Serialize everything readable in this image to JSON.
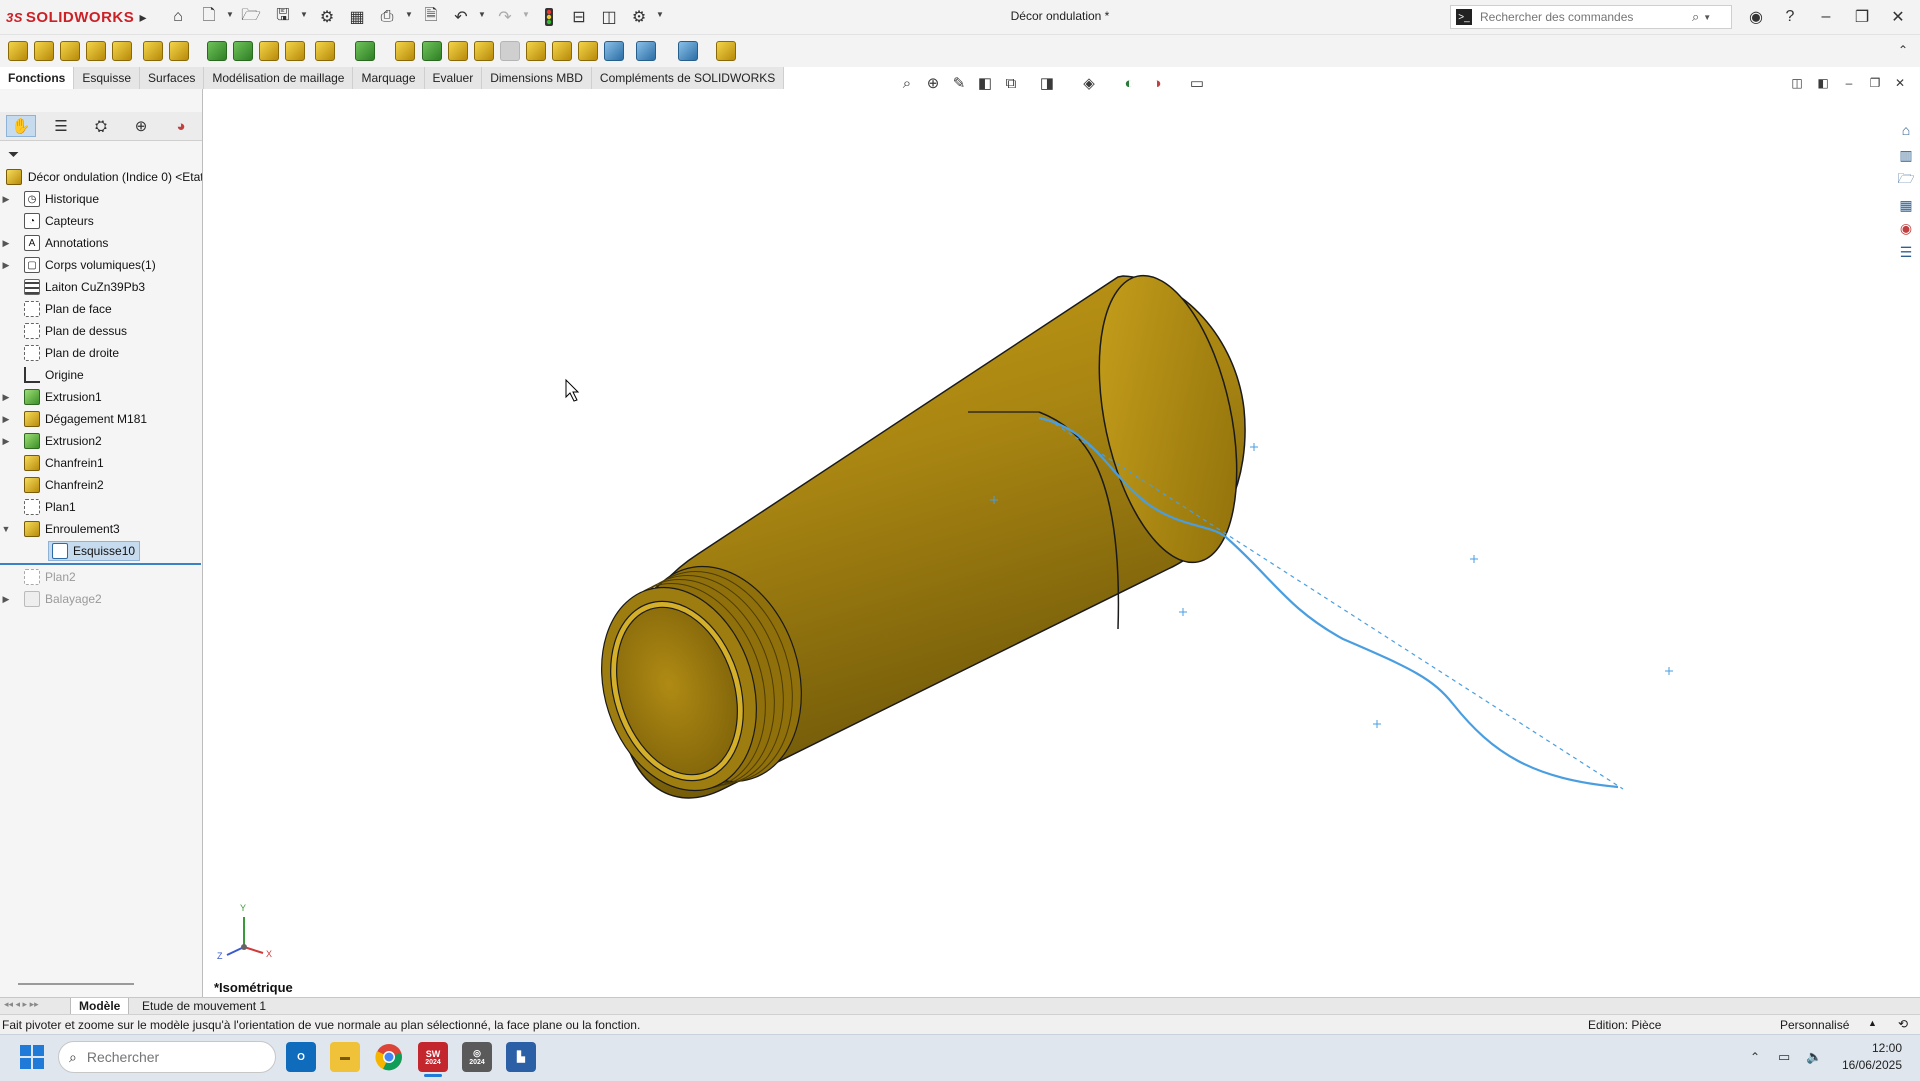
{
  "app": {
    "logo_brand": "SOLIDWORKS",
    "document_title": "Décor ondulation *",
    "search_placeholder": "Rechercher des commandes"
  },
  "tabs": [
    "Fonctions",
    "Esquisse",
    "Surfaces",
    "Modélisation de maillage",
    "Marquage",
    "Evaluer",
    "Dimensions MBD",
    "Compléments de SOLIDWORKS"
  ],
  "tree": {
    "root": "Décor ondulation (Indice 0) <Etat",
    "items": [
      {
        "label": "Historique"
      },
      {
        "label": "Capteurs"
      },
      {
        "label": "Annotations"
      },
      {
        "label": "Corps volumiques(1)"
      },
      {
        "label": "Laiton CuZn39Pb3"
      },
      {
        "label": "Plan de face"
      },
      {
        "label": "Plan de dessus"
      },
      {
        "label": "Plan de droite"
      },
      {
        "label": "Origine"
      },
      {
        "label": "Extrusion1"
      },
      {
        "label": "Dégagement M181"
      },
      {
        "label": "Extrusion2"
      },
      {
        "label": "Chanfrein1"
      },
      {
        "label": "Chanfrein2"
      },
      {
        "label": "Plan1"
      },
      {
        "label": "Enroulement3"
      },
      {
        "label": "Esquisse10"
      },
      {
        "label": "Plan2"
      },
      {
        "label": "Balayage2"
      }
    ]
  },
  "viewport": {
    "view_label": "*Isométrique",
    "triad": {
      "x": "X",
      "y": "Y",
      "z": "Z"
    }
  },
  "bottom_tabs": [
    "Modèle",
    "Etude de mouvement 1"
  ],
  "status": {
    "message": "Fait pivoter et zoome sur le modèle jusqu'à l'orientation de vue normale au plan sélectionné, la face plane ou la fonction.",
    "edition": "Edition: Pièce",
    "units": "Personnalisé"
  },
  "taskbar": {
    "search_placeholder": "Rechercher",
    "sw_badge": "2024",
    "sw_badge2": "2024",
    "time": "12:00",
    "date": "16/06/2025"
  },
  "colors": {
    "brass": "#a88512",
    "curve": "#4a9ee0",
    "brand": "#cc2027",
    "selection": "#c7dbef"
  }
}
